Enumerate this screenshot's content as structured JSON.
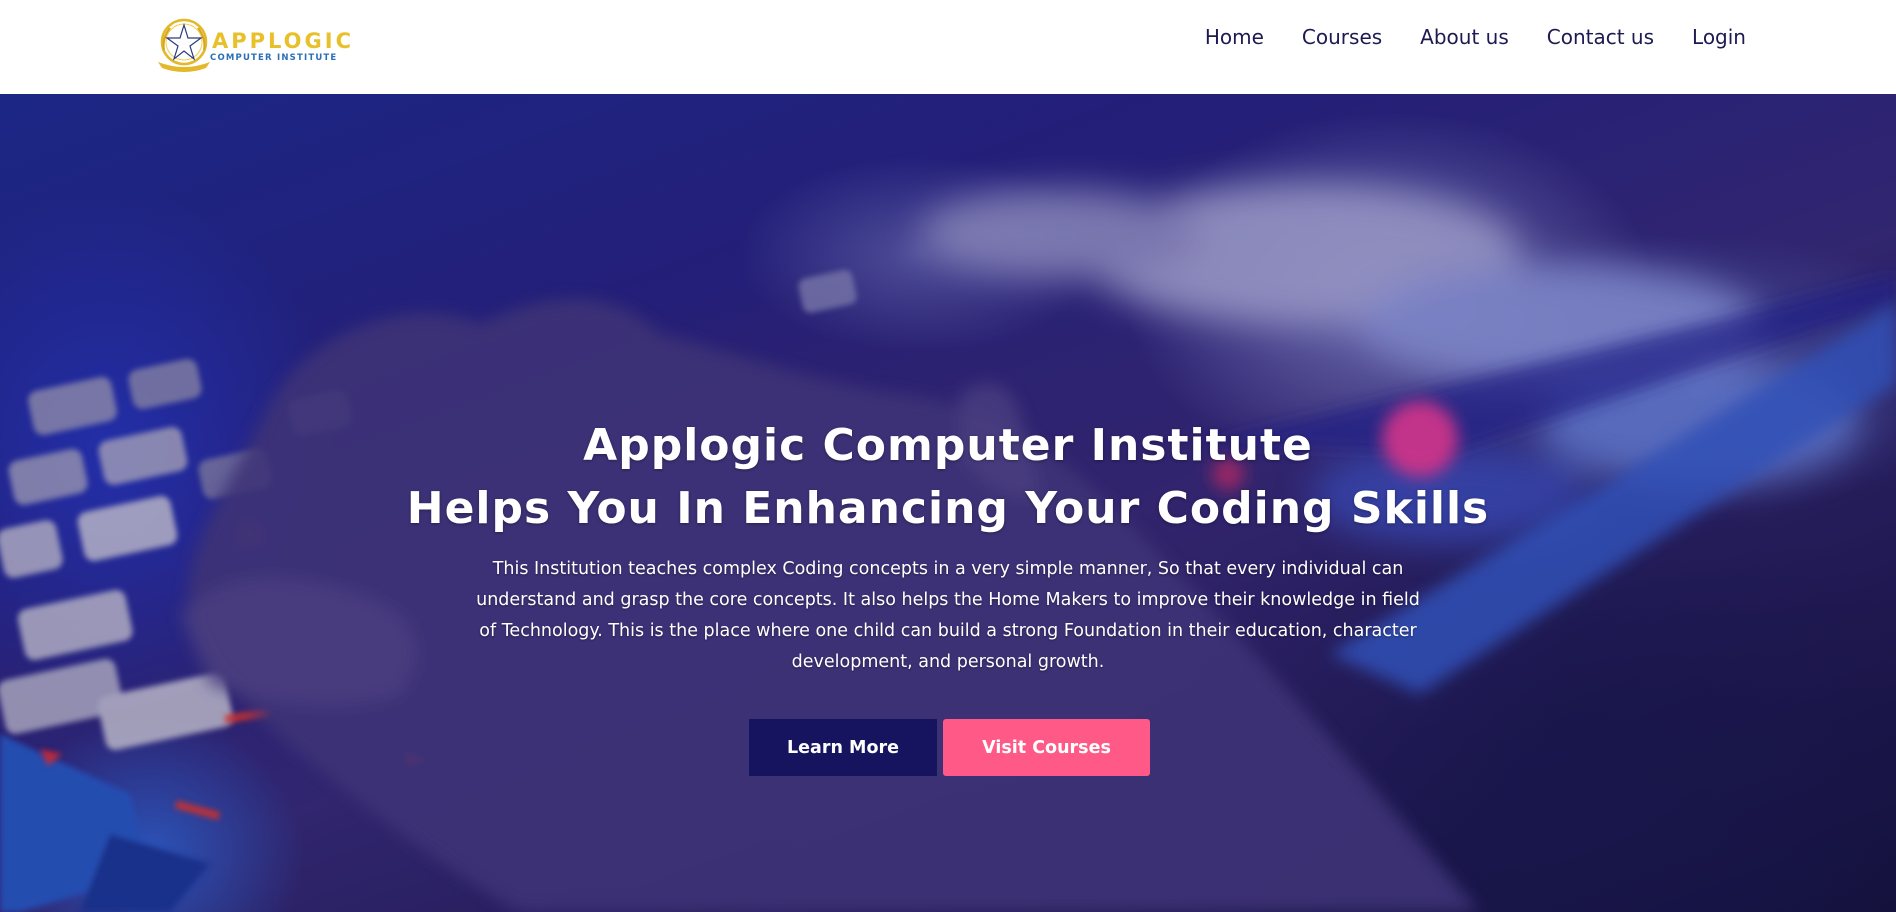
{
  "brand": {
    "name": "APPLOGIC",
    "tagline": "COMPUTER INSTITUTE"
  },
  "nav": {
    "items": [
      {
        "label": "Home"
      },
      {
        "label": "Courses"
      },
      {
        "label": "About us"
      },
      {
        "label": "Contact us"
      },
      {
        "label": "Login"
      }
    ]
  },
  "hero": {
    "title_line1": "Applogic Computer Institute",
    "title_line2": "Helps You In Enhancing Your Coding Skills",
    "description": "This Institution teaches complex Coding concepts in a very simple manner, So that every individual can understand and grasp the core concepts. It also helps the Home Makers to improve their knowledge in field of Technology. This is the place where one child can build a strong Foundation in their education, character development, and personal growth.",
    "background_image": "hand-on-backlit-keyboard-photo",
    "buttons": {
      "learn_more": "Learn More",
      "visit_courses": "Visit Courses"
    }
  },
  "colors": {
    "nav_text": "#1d1a52",
    "logo_gold": "#e8c12a",
    "logo_blue": "#2a6fb8",
    "learn_more_bg": "#16145e",
    "visit_courses_bg": "#ff5a87"
  }
}
